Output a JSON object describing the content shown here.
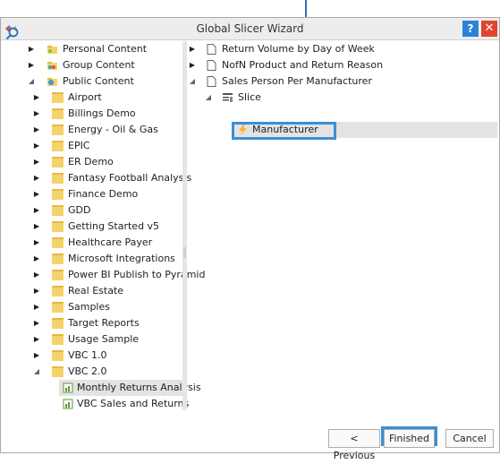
{
  "dialog": {
    "title": "Global Slicer Wizard",
    "help_label": "?",
    "close_label": "✕"
  },
  "left_tree": {
    "items": [
      {
        "label": "Personal Content",
        "icon": "personal-content-icon",
        "expanded": false
      },
      {
        "label": "Group Content",
        "icon": "group-content-icon",
        "expanded": false
      },
      {
        "label": "Public Content",
        "icon": "public-content-icon",
        "expanded": true
      },
      {
        "label": "Airport",
        "icon": "folder-icon",
        "expanded": false
      },
      {
        "label": "Billings Demo",
        "icon": "folder-icon",
        "expanded": false
      },
      {
        "label": "Energy - Oil & Gas",
        "icon": "folder-icon",
        "expanded": false
      },
      {
        "label": "EPIC",
        "icon": "folder-icon",
        "expanded": false
      },
      {
        "label": "ER Demo",
        "icon": "folder-icon",
        "expanded": false
      },
      {
        "label": "Fantasy Football Analysis",
        "icon": "folder-icon",
        "expanded": false
      },
      {
        "label": "Finance Demo",
        "icon": "folder-icon",
        "expanded": false
      },
      {
        "label": "GDD",
        "icon": "folder-icon",
        "expanded": false
      },
      {
        "label": "Getting Started v5",
        "icon": "folder-icon",
        "expanded": false
      },
      {
        "label": "Healthcare Payer",
        "icon": "folder-icon",
        "expanded": false
      },
      {
        "label": "Microsoft Integrations",
        "icon": "folder-icon",
        "expanded": false
      },
      {
        "label": "Power BI Publish to Pyramid",
        "icon": "folder-icon",
        "expanded": false
      },
      {
        "label": "Real Estate",
        "icon": "folder-icon",
        "expanded": false
      },
      {
        "label": "Samples",
        "icon": "folder-icon",
        "expanded": false
      },
      {
        "label": "Target Reports",
        "icon": "folder-icon",
        "expanded": false
      },
      {
        "label": "Usage Sample",
        "icon": "folder-icon",
        "expanded": false
      },
      {
        "label": "VBC 1.0",
        "icon": "folder-icon",
        "expanded": false
      },
      {
        "label": "VBC 2.0",
        "icon": "folder-icon",
        "expanded": true
      },
      {
        "label": "Monthly Returns Analysis",
        "icon": "report-icon",
        "selected": true
      },
      {
        "label": "VBC Sales and Returns",
        "icon": "report-icon"
      }
    ]
  },
  "right_tree": {
    "items": [
      {
        "label": "Return Volume by Day of Week",
        "icon": "page-icon",
        "expanded": false
      },
      {
        "label": "NofN Product and Return Reason",
        "icon": "page-icon",
        "expanded": false
      },
      {
        "label": "Sales Person Per Manufacturer",
        "icon": "page-icon",
        "expanded": true
      },
      {
        "label": "Slice",
        "icon": "slice-icon",
        "expanded": true
      },
      {
        "label": "Manufacturer",
        "icon": "lightning-icon",
        "selected": true
      }
    ]
  },
  "buttons": {
    "previous": "< Previous",
    "finished": "Finished",
    "cancel": "Cancel"
  },
  "colors": {
    "highlight": "#3c8fd4",
    "folder": "#f3d36a",
    "help": "#2a83d6",
    "close": "#e0452b"
  }
}
